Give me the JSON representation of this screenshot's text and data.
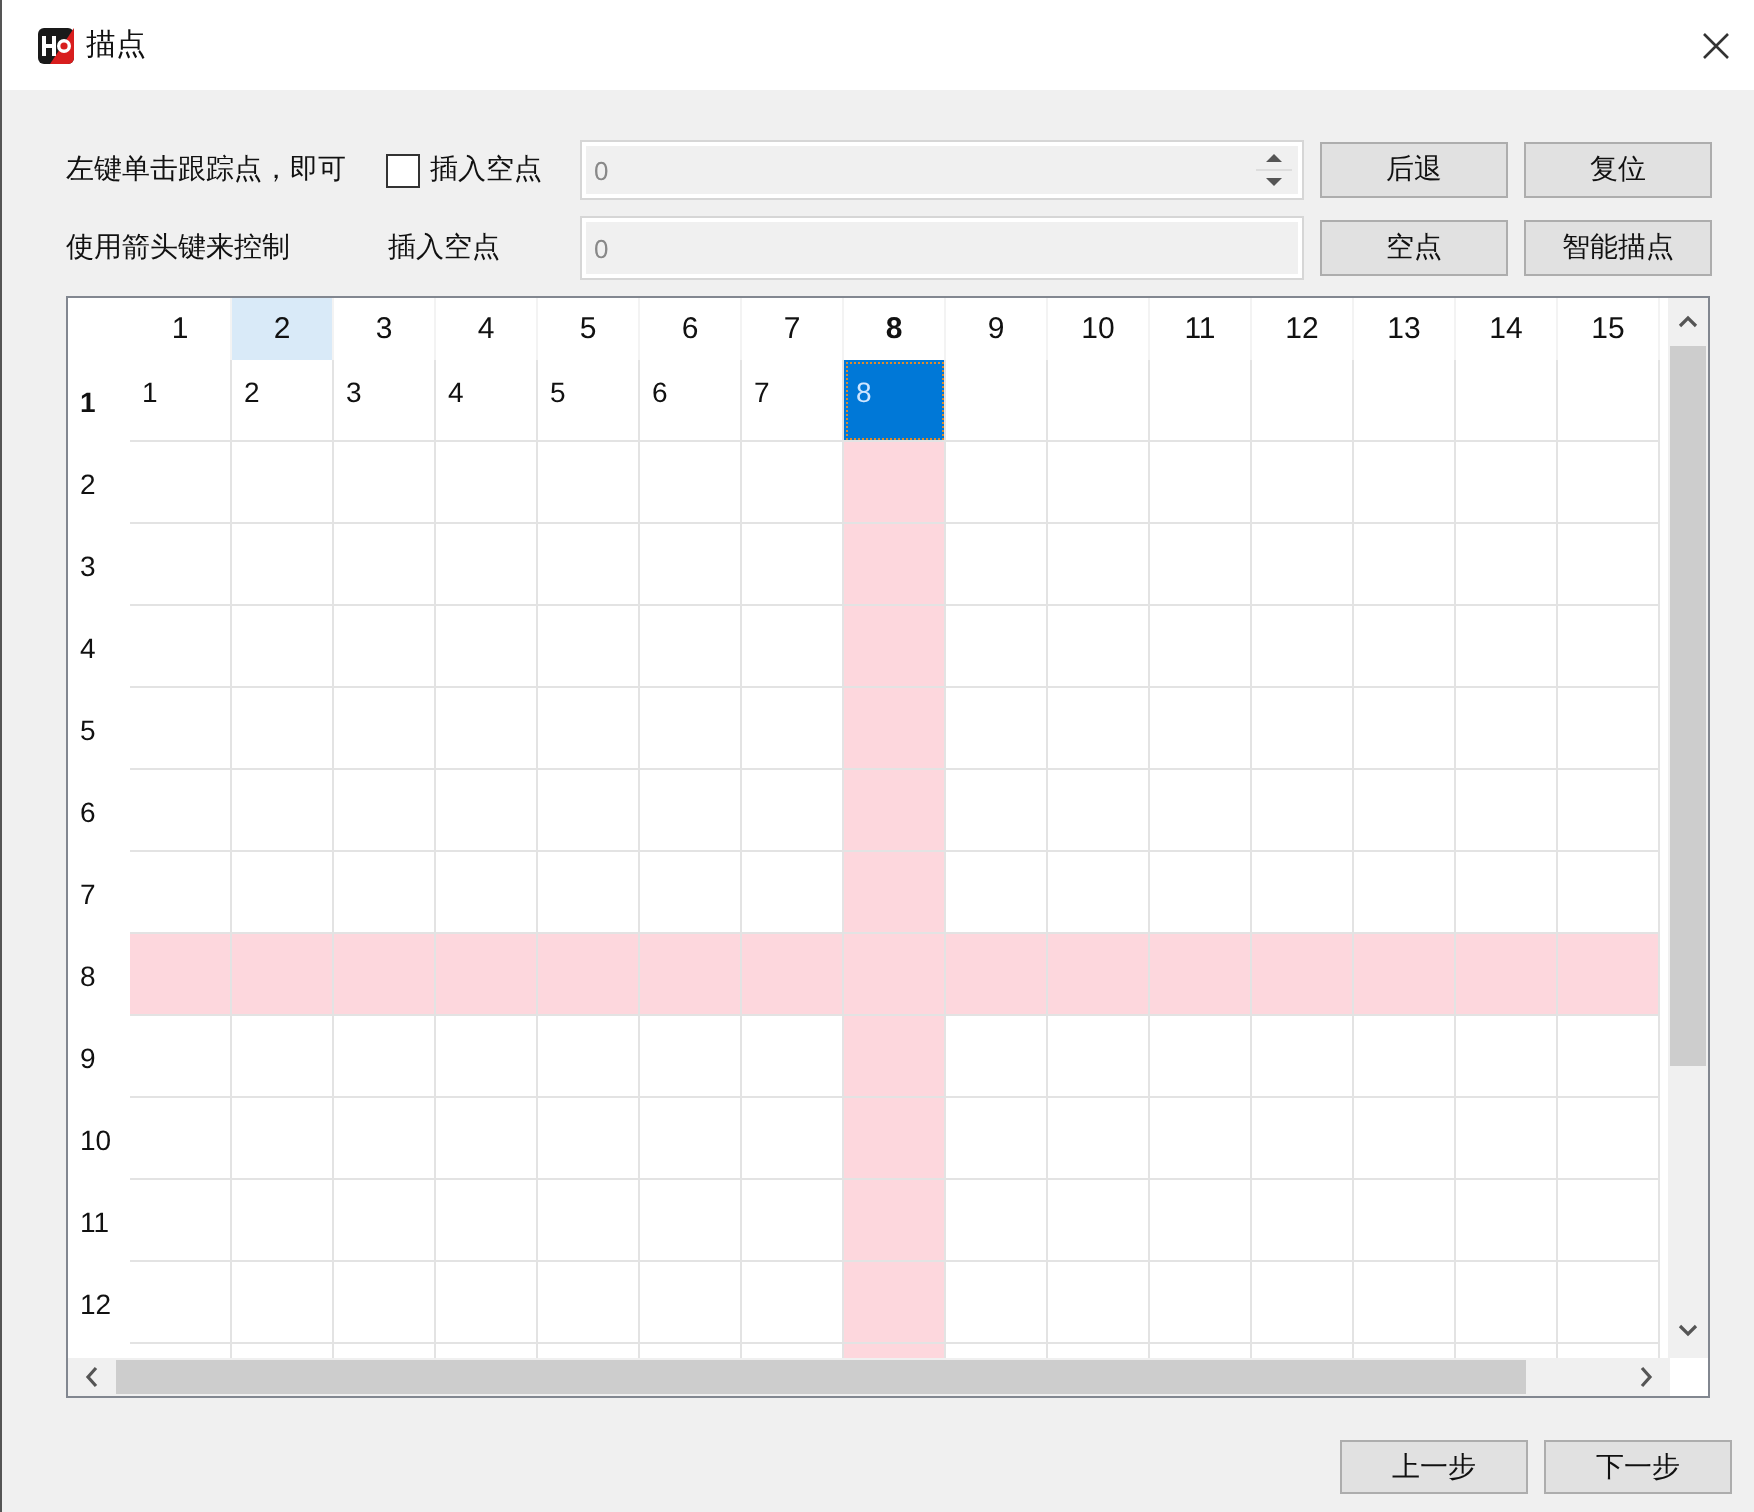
{
  "window": {
    "title": "描点"
  },
  "controls": {
    "hint_line_1": "左键单击跟踪点，即可",
    "insert_checkbox": {
      "label": "插入空点",
      "checked": false
    },
    "spin_field": {
      "value": "0"
    },
    "hint_line_2": "使用箭头键来控制",
    "insert_label": "插入空点",
    "insert_field": {
      "value": "0"
    },
    "buttons": [
      {
        "label": "后退"
      },
      {
        "label": "复位"
      },
      {
        "label": "空点"
      },
      {
        "label": "智能描点"
      }
    ]
  },
  "grid": {
    "columns": [
      {
        "label": "1",
        "active": false,
        "highlighted": false,
        "hovered": false
      },
      {
        "label": "2",
        "active": false,
        "highlighted": false,
        "hovered": true
      },
      {
        "label": "3",
        "active": false,
        "highlighted": false,
        "hovered": false
      },
      {
        "label": "4",
        "active": false,
        "highlighted": false,
        "hovered": false
      },
      {
        "label": "5",
        "active": false,
        "highlighted": false,
        "hovered": false
      },
      {
        "label": "6",
        "active": false,
        "highlighted": false,
        "hovered": false
      },
      {
        "label": "7",
        "active": false,
        "highlighted": false,
        "hovered": false
      },
      {
        "label": "8",
        "active": true,
        "highlighted": true,
        "hovered": false
      },
      {
        "label": "9",
        "active": false,
        "highlighted": false,
        "hovered": false
      },
      {
        "label": "10",
        "active": false,
        "highlighted": false,
        "hovered": false
      },
      {
        "label": "11",
        "active": false,
        "highlighted": false,
        "hovered": false
      },
      {
        "label": "12",
        "active": false,
        "highlighted": false,
        "hovered": false
      },
      {
        "label": "13",
        "active": false,
        "highlighted": false,
        "hovered": false
      },
      {
        "label": "14",
        "active": false,
        "highlighted": false,
        "hovered": false
      },
      {
        "label": "15",
        "active": false,
        "highlighted": false,
        "hovered": false
      }
    ],
    "rows": [
      {
        "label": "1",
        "active": true,
        "highlighted": false,
        "cells": [
          {
            "text": "1",
            "selected": false
          },
          {
            "text": "2",
            "selected": false
          },
          {
            "text": "3",
            "selected": false
          },
          {
            "text": "4",
            "selected": false
          },
          {
            "text": "5",
            "selected": false
          },
          {
            "text": "6",
            "selected": false
          },
          {
            "text": "7",
            "selected": false
          },
          {
            "text": "8",
            "selected": true
          }
        ]
      },
      {
        "label": "2",
        "active": false,
        "highlighted": false
      },
      {
        "label": "3",
        "active": false,
        "highlighted": false
      },
      {
        "label": "4",
        "active": false,
        "highlighted": false
      },
      {
        "label": "5",
        "active": false,
        "highlighted": false
      },
      {
        "label": "6",
        "active": false,
        "highlighted": false
      },
      {
        "label": "7",
        "active": false,
        "highlighted": false
      },
      {
        "label": "8",
        "active": false,
        "highlighted": true
      },
      {
        "label": "9",
        "active": false,
        "highlighted": false
      },
      {
        "label": "10",
        "active": false,
        "highlighted": false
      },
      {
        "label": "11",
        "active": false,
        "highlighted": false
      },
      {
        "label": "12",
        "active": false,
        "highlighted": false
      }
    ]
  },
  "footer_buttons": [
    {
      "label": "上一步"
    },
    {
      "label": "下一步"
    }
  ]
}
